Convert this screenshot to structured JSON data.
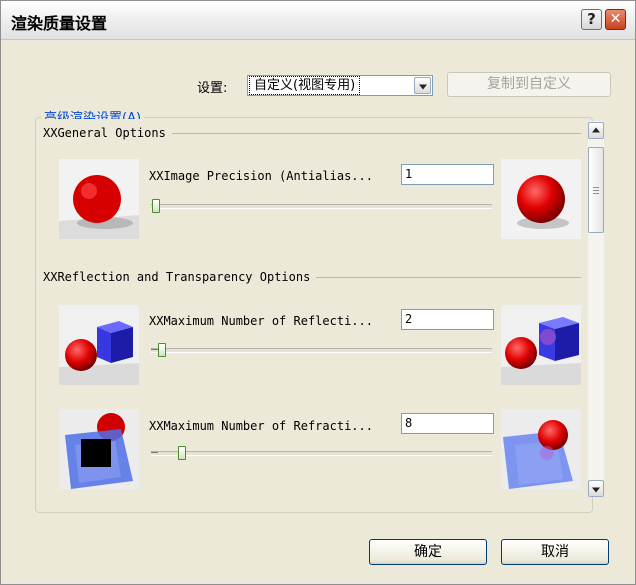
{
  "window": {
    "title": "渲染质量设置",
    "help_glyph": "?",
    "close_glyph": "✕"
  },
  "settings": {
    "label": "设置:",
    "preset_value": "自定义(视图专用)",
    "copy_button_label": "复制到自定义"
  },
  "advanced": {
    "group_label": "高级渲染设置(A)",
    "sections": [
      {
        "title": "XXGeneral Options",
        "options": [
          {
            "label": "XXImage Precision (Antialias...",
            "value": "1",
            "slider_fraction": 0.0
          }
        ]
      },
      {
        "title": "XXReflection and Transparency Options",
        "options": [
          {
            "label": "XXMaximum Number of Reflecti...",
            "value": "2",
            "slider_fraction": 0.04
          },
          {
            "label": "XXMaximum Number of Refracti...",
            "value": "8",
            "slider_fraction": 0.1
          }
        ]
      }
    ],
    "scrollbar_grip": "≡"
  },
  "footer": {
    "ok_label": "确定",
    "cancel_label": "取消"
  },
  "colors": {
    "dialog_bg": "#ece9d8",
    "accent_blue": "#0046d5",
    "sphere_red": "#e00000",
    "cube_blue": "#2a2ad8"
  },
  "icons": {
    "help": "question-icon",
    "close": "close-icon",
    "dropdown": "chevron-down-icon",
    "scroll_up": "chevron-up-icon",
    "scroll_down": "chevron-down-icon"
  }
}
